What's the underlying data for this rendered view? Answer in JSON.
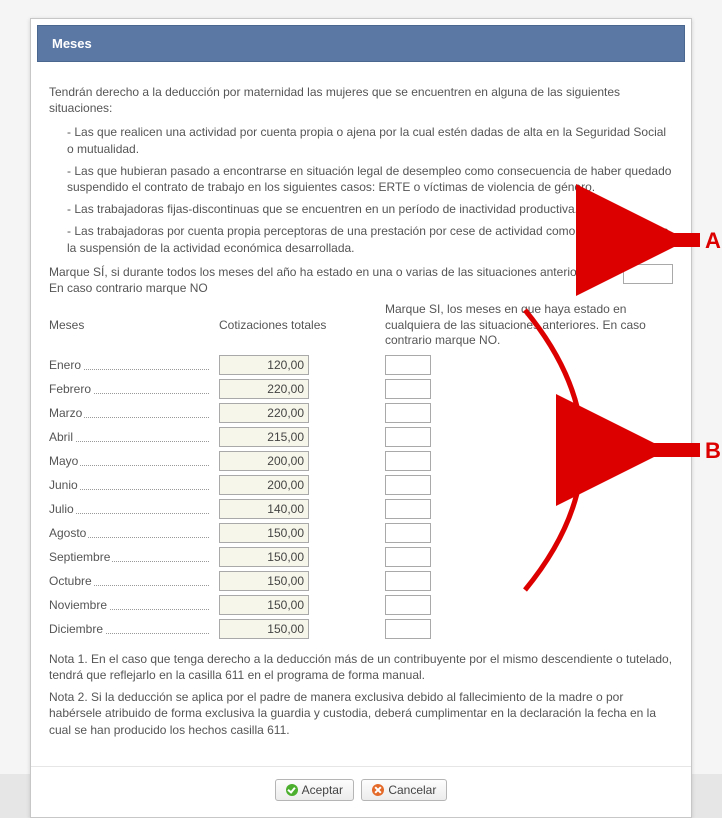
{
  "header": {
    "title": "Meses"
  },
  "intro": "Tendrán derecho a la deducción por maternidad las mujeres que se encuentren en alguna de las siguientes situaciones:",
  "bullets": [
    "Las que realicen una actividad por cuenta propia o ajena por la cual estén dadas de alta en la Seguridad Social o mutualidad.",
    "Las que hubieran pasado a encontrarse en situación legal de desempleo como consecuencia de haber quedado suspendido el contrato de trabajo en los siguientes casos: ERTE o víctimas de violencia de género.",
    "Las trabajadoras fijas-discontinuas que se encuentren en un período de inactividad productiva.",
    "Las trabajadoras por cuenta propia perceptoras de una prestación por cese de actividad como consecuencia de la suspensión de la actividad económica desarrollada."
  ],
  "question_all_year": "Marque SÍ, si durante todos los meses del año ha estado en una o varias de las situaciones anteriores. En caso contrario marque NO",
  "question_all_year_value": "",
  "columns": {
    "meses": "Meses",
    "cotizaciones": "Cotizaciones totales",
    "marque_si": "Marque SI, los meses en que haya estado en cualquiera de las situaciones anteriores. En caso contrario marque NO."
  },
  "rows": [
    {
      "month": "Enero",
      "value": "120,00",
      "si": ""
    },
    {
      "month": "Febrero",
      "value": "220,00",
      "si": ""
    },
    {
      "month": "Marzo",
      "value": "220,00",
      "si": ""
    },
    {
      "month": "Abril",
      "value": "215,00",
      "si": ""
    },
    {
      "month": "Mayo",
      "value": "200,00",
      "si": ""
    },
    {
      "month": "Junio",
      "value": "200,00",
      "si": ""
    },
    {
      "month": "Julio",
      "value": "140,00",
      "si": ""
    },
    {
      "month": "Agosto",
      "value": "150,00",
      "si": ""
    },
    {
      "month": "Septiembre",
      "value": "150,00",
      "si": ""
    },
    {
      "month": "Octubre",
      "value": "150,00",
      "si": ""
    },
    {
      "month": "Noviembre",
      "value": "150,00",
      "si": ""
    },
    {
      "month": "Diciembre",
      "value": "150,00",
      "si": ""
    }
  ],
  "notes": [
    "Nota 1. En el caso que tenga derecho a la deducción más de un contribuyente por el mismo descendiente o tutelado, tendrá que reflejarlo en la casilla 611 en el programa de forma manual.",
    "Nota 2. Si la deducción se aplica por el padre de manera exclusiva debido al fallecimiento de la madre o por habérsele atribuido de forma exclusiva la guardia y custodia, deberá cumplimentar en la declaración la fecha en la cual se han producido los hechos casilla 611."
  ],
  "buttons": {
    "accept": "Aceptar",
    "cancel": "Cancelar"
  },
  "markers": {
    "a": "A",
    "b": "B"
  }
}
